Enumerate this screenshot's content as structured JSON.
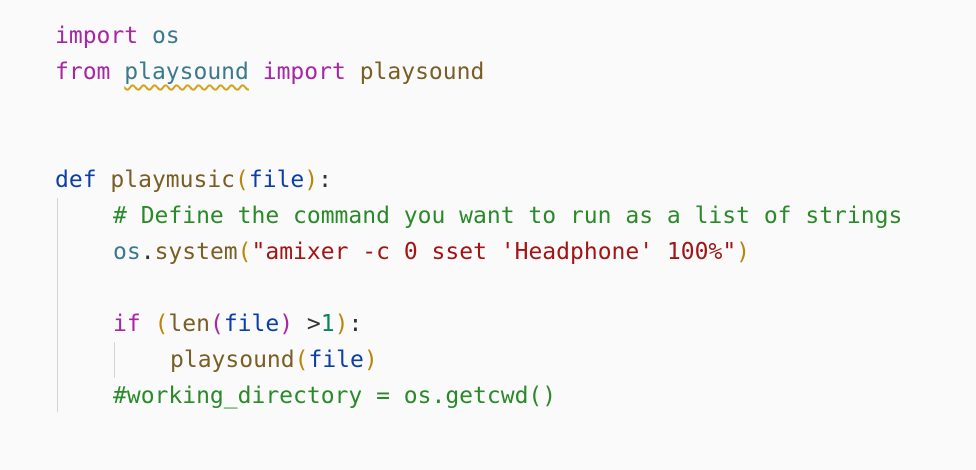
{
  "code": {
    "l1": {
      "kw": "import",
      "mod": "os"
    },
    "l2": {
      "kw1": "from",
      "mod": "playsound",
      "kw2": "import",
      "name": "playsound"
    },
    "l5": {
      "kw": "def",
      "fn": "playmusic",
      "open": "(",
      "param": "file",
      "close": ")",
      "colon": ":"
    },
    "l6": {
      "comment": "# Define the command you want to run as a list of strings"
    },
    "l7": {
      "mod": "os",
      "dot": ".",
      "fn": "system",
      "open": "(",
      "str": "\"amixer -c 0 sset 'Headphone' 100%\"",
      "close": ")"
    },
    "l9": {
      "kw": "if",
      "open1": "(",
      "fn": "len",
      "open2": "(",
      "param": "file",
      "close2": ")",
      "op": " >",
      "num": "1",
      "close1": ")",
      "colon": ":"
    },
    "l10": {
      "fn": "playsound",
      "open": "(",
      "param": "file",
      "close": ")"
    },
    "l11": {
      "comment": "#working_directory = os.getcwd()"
    }
  }
}
